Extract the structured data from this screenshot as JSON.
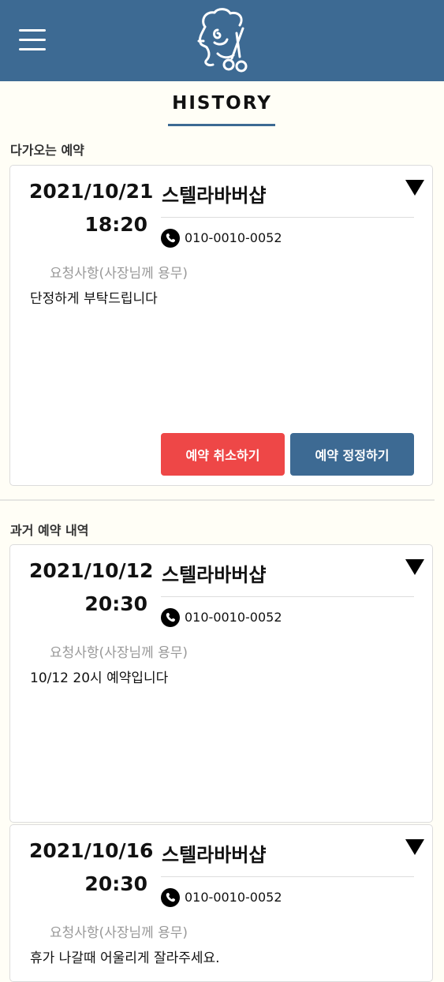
{
  "header": {
    "menu_icon": "hamburger-menu-icon",
    "logo_icon": "barber-scissors-logo",
    "bar_color": "#3d6a93"
  },
  "page": {
    "title": "HISTORY"
  },
  "upcoming": {
    "section_label": "다가오는 예약",
    "cards": [
      {
        "date": "2021/10/21",
        "time": "18:20",
        "shop": "스텔라바버샵",
        "phone": "010-0010-0052",
        "request_label": "요청사항(사장님께 용무)",
        "request_text": "단정하게 부탁드립니다",
        "cancel_label": "예약 취소하기",
        "change_label": "예약 정정하기"
      }
    ]
  },
  "past": {
    "section_label": "과거 예약 내역",
    "cards": [
      {
        "date": "2021/10/12",
        "time": "20:30",
        "shop": "스텔라바버샵",
        "phone": "010-0010-0052",
        "request_label": "요청사항(사장님께 용무)",
        "request_text": "10/12 20시 예약입니다"
      },
      {
        "date": "2021/10/16",
        "time": "20:30",
        "shop": "스텔라바버샵",
        "phone": "010-0010-0052",
        "request_label": "요청사항(사장님께 용무)",
        "request_text": "휴가 나갈때 어울리게 잘라주세요."
      }
    ]
  },
  "colors": {
    "accent": "#3d6a93",
    "danger": "#ee4747",
    "background": "#fffef6"
  }
}
